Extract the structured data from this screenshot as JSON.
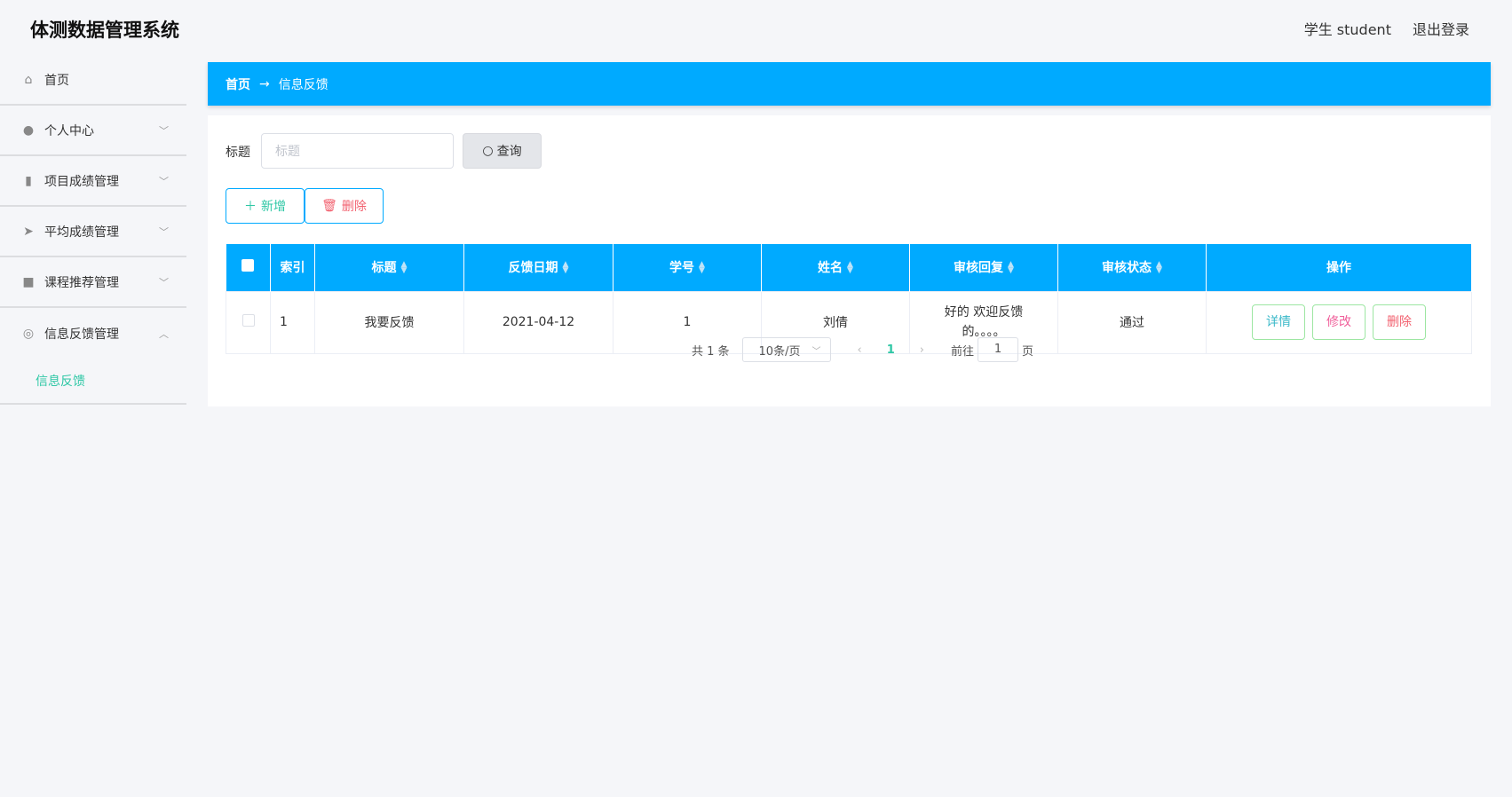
{
  "header": {
    "title": "体测数据管理系统",
    "user": "学生 student",
    "logout": "退出登录"
  },
  "sidebar": {
    "items": [
      {
        "label": "首页",
        "icon": "home-icon"
      },
      {
        "label": "个人中心",
        "icon": "user-icon"
      },
      {
        "label": "项目成绩管理",
        "icon": "bar-chart-icon"
      },
      {
        "label": "平均成绩管理",
        "icon": "send-icon"
      },
      {
        "label": "课程推荐管理",
        "icon": "briefcase-icon"
      },
      {
        "label": "信息反馈管理",
        "icon": "gauge-icon"
      }
    ],
    "sub": "信息反馈"
  },
  "breadcrumb": {
    "home": "首页",
    "sep": "→",
    "current": "信息反馈"
  },
  "search": {
    "label": "标题",
    "placeholder": "标题",
    "button": "查询"
  },
  "actions": {
    "add": "新增",
    "delete": "删除"
  },
  "table": {
    "headers": [
      "索引",
      "标题",
      "反馈日期",
      "学号",
      "姓名",
      "审核回复",
      "审核状态",
      "操作"
    ],
    "rows": [
      {
        "index": "1",
        "title": "我要反馈",
        "date": "2021-04-12",
        "id": "1",
        "name": "刘倩",
        "reply": "好的 欢迎反馈的。。。。",
        "status": "通过"
      }
    ],
    "ops": {
      "detail": "详情",
      "edit": "修改",
      "delete": "删除"
    },
    "colors": {
      "detail": "#3bb9c9",
      "edit": "#f0609b",
      "delete": "#f2616f"
    }
  },
  "pagination": {
    "total": "共 1 条",
    "page_size": "10条/页",
    "current": "1",
    "goto": "前往",
    "goto_value": "1",
    "page_suffix": "页"
  }
}
